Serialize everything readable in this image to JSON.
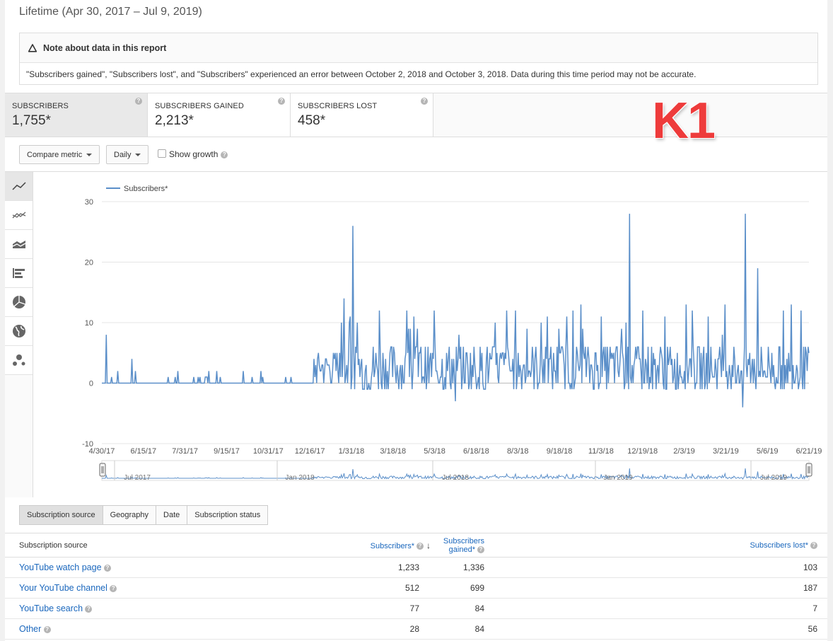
{
  "header": {
    "lifetime": "Lifetime (Apr 30, 2017 – Jul 9, 2019)"
  },
  "note": {
    "title": "Note about data in this report",
    "body": "\"Subscribers gained\", \"Subscribers lost\", and \"Subscribers\" experienced an error between October 2, 2018 and October 3, 2018. Data during this time period may not be accurate."
  },
  "metrics": [
    {
      "label": "SUBSCRIBERS",
      "value": "1,755*"
    },
    {
      "label": "SUBSCRIBERS GAINED",
      "value": "2,213*"
    },
    {
      "label": "SUBSCRIBERS LOST",
      "value": "458*"
    }
  ],
  "overlay": {
    "text": "K1",
    "color": "#ee3b3b"
  },
  "controls": {
    "compare": "Compare metric",
    "granularity": "Daily",
    "show_growth": "Show growth"
  },
  "sidebar_icons": [
    "line-chart-icon",
    "multi-line-chart-icon",
    "stacked-area-chart-icon",
    "bar-chart-icon",
    "pie-chart-icon",
    "globe-icon",
    "bubble-chart-icon"
  ],
  "chart_data": {
    "type": "line",
    "series": [
      {
        "name": "Subscribers*",
        "color": "#5b8fc9"
      }
    ],
    "ylim": [
      -10,
      30
    ],
    "yticks": [
      "30",
      "20",
      "10",
      "0",
      "-10"
    ],
    "xticks": [
      "4/30/17",
      "6/15/17",
      "7/31/17",
      "9/15/17",
      "10/31/17",
      "12/16/17",
      "1/31/18",
      "3/18/18",
      "5/3/18",
      "6/18/18",
      "8/3/18",
      "9/18/18",
      "11/3/18",
      "12/19/18",
      "2/3/19",
      "3/21/19",
      "5/6/19",
      "6/21/19"
    ],
    "navigator_labels": [
      "Jul 2017",
      "Jan 2018",
      "Jul 2018",
      "Jan 2019",
      "Jul 2019"
    ],
    "day_count": 801,
    "key_points": [
      {
        "date": "5/5/17",
        "value": 8
      },
      {
        "date": "6/3/17",
        "value": 4
      },
      {
        "date": "1/29/18",
        "value": 14
      },
      {
        "date": "2/8/18",
        "value": 26
      },
      {
        "date": "3/10/18",
        "value": 12
      },
      {
        "date": "6/4/18",
        "value": -3
      },
      {
        "date": "8/1/18",
        "value": 12
      },
      {
        "date": "12/18/18",
        "value": 28
      },
      {
        "date": "4/25/19",
        "value": -4
      },
      {
        "date": "4/28/19",
        "value": 28
      },
      {
        "date": "5/12/19",
        "value": 19
      }
    ],
    "grid": true,
    "legend": "top-left"
  },
  "tabs": [
    {
      "label": "Subscription source"
    },
    {
      "label": "Geography"
    },
    {
      "label": "Date"
    },
    {
      "label": "Subscription status"
    }
  ],
  "table": {
    "columns": [
      "Subscription source",
      "Subscribers*",
      "Subscribers gained*",
      "Subscribers lost*"
    ],
    "rows": [
      {
        "source": "YouTube watch page",
        "subs": "1,233",
        "gained": "1,336",
        "lost": "103"
      },
      {
        "source": "Your YouTube channel",
        "subs": "512",
        "gained": "699",
        "lost": "187"
      },
      {
        "source": "YouTube search",
        "subs": "77",
        "gained": "84",
        "lost": "7"
      },
      {
        "source": "Other",
        "subs": "28",
        "gained": "84",
        "lost": "56"
      }
    ]
  }
}
